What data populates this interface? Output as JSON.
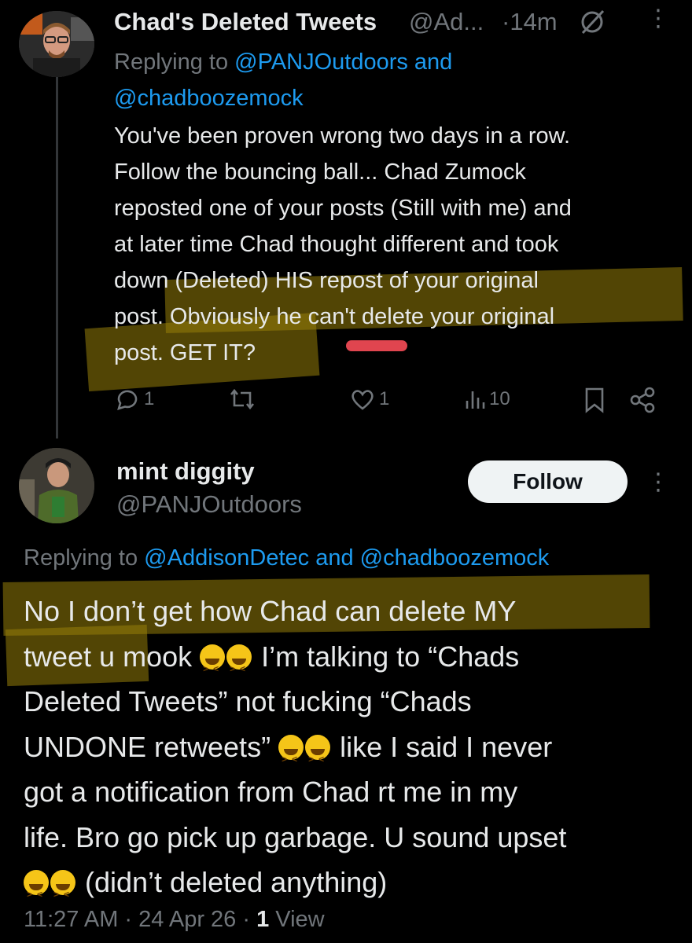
{
  "tweet1": {
    "display_name": "Chad's Deleted Tweets",
    "handle": "@Ad...",
    "time": "·14m",
    "replying_prefix": "Replying to",
    "replying_to_1": "@PANJOutdoors",
    "replying_and": "and",
    "replying_to_2": "@chadboozemock",
    "lines": [
      "You've been proven wrong two days in a row.",
      "Follow the bouncing ball... Chad Zumock",
      "reposted one of your posts (Still with me) and",
      "at later time Chad thought different and took",
      "down (Deleted) HIS repost of your original",
      "post. Obviously he can't delete your original",
      "post. GET IT?"
    ],
    "actions": {
      "reply_count": "1",
      "like_count": "1",
      "view_count": "10"
    }
  },
  "tweet2": {
    "display_name": "mint diggity",
    "handle": "@PANJOutdoors",
    "follow_label": "Follow",
    "replying_prefix": "Replying to",
    "replying_to": "@AddisonDetec and @chadboozemock",
    "lines": [
      "No I don’t get how Chad can delete MY",
      "tweet u mook",
      " I’m talking to “Chads",
      "Deleted Tweets” not fucking “Chads",
      "UNDONE retweets”",
      " like I said I never",
      "got a notification from Chad rt me in my",
      "life. Bro go pick up garbage. U sound upset",
      " (didn’t deleted anything)"
    ],
    "timestamp": "11:27 AM · 24 Apr 26 · ",
    "view_count": "1",
    "view_label": " View"
  },
  "colors": {
    "background": "#000000",
    "text": "#e7e9ea",
    "muted": "#71767b",
    "link": "#1d9bf0",
    "highlight": "#967d0a",
    "red_mark": "#e0454f"
  }
}
